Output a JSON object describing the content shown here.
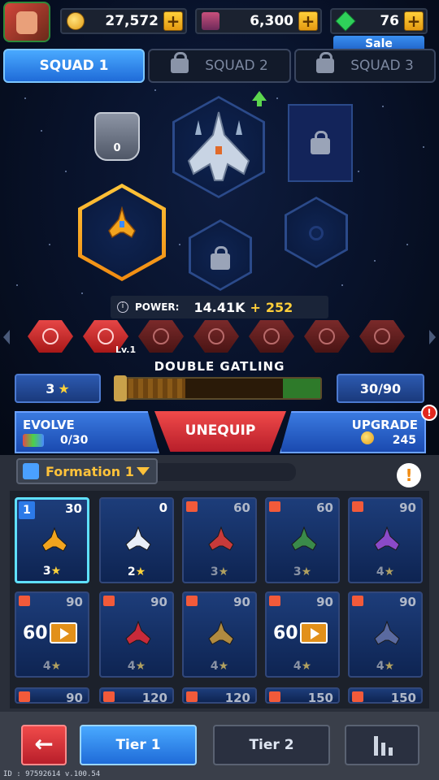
{
  "currency": {
    "coins": "27,572",
    "cards": "6,300",
    "gems": "76",
    "plus": "+",
    "sale_label": "Sale"
  },
  "tabs": [
    {
      "label": "SQUAD 1",
      "active": true
    },
    {
      "label": "SQUAD 2",
      "active": false
    },
    {
      "label": "SQUAD 3",
      "active": false
    }
  ],
  "formation_slots": {
    "rank_badge_value": "0"
  },
  "power": {
    "label": "POWER:",
    "value": "14.41K",
    "plus": "+",
    "bonus": "252"
  },
  "skills": {
    "level_label": "Lv.1"
  },
  "weapon": {
    "name": "DOUBLE GATLING",
    "stars": "3",
    "xp": "30/90",
    "xp_progress": 0.33
  },
  "actions": {
    "evolve_label": "EVOLVE",
    "evolve_progress": "0/30",
    "unequip_label": "UNEQUIP",
    "upgrade_label": "UPGRADE",
    "upgrade_cost": "245"
  },
  "formation": {
    "label": "Formation 1"
  },
  "cards": [
    {
      "slot": "1",
      "num": "30",
      "stars": "3",
      "locked": false,
      "selected": true,
      "color": "#f2a41e"
    },
    {
      "num": "0",
      "stars": "2",
      "locked": false,
      "selected": false,
      "color": "#e8eef8"
    },
    {
      "num": "60",
      "stars": "3",
      "locked": true,
      "color": "#c83a3a"
    },
    {
      "num": "60",
      "stars": "3",
      "locked": true,
      "color": "#3a8a4a"
    },
    {
      "num": "90",
      "stars": "4",
      "locked": true,
      "color": "#8a4ac8"
    },
    {
      "num": "90",
      "stars": "4",
      "locked": true,
      "ad": "60",
      "color": "#c8a04a"
    },
    {
      "num": "90",
      "stars": "4",
      "locked": true,
      "color": "#c82a3a"
    },
    {
      "num": "90",
      "stars": "4",
      "locked": true,
      "color": "#b08a40"
    },
    {
      "num": "90",
      "stars": "4",
      "locked": true,
      "ad": "60",
      "color": "#c8a04a"
    },
    {
      "num": "90",
      "stars": "4",
      "locked": true,
      "color": "#5a6aa0"
    },
    {
      "num": "90"
    },
    {
      "num": "120"
    },
    {
      "num": "120"
    },
    {
      "num": "150"
    },
    {
      "num": "150"
    }
  ],
  "bottom": {
    "back_glyph": "←",
    "tier1": "Tier 1",
    "tier2": "Tier 2"
  },
  "footer": {
    "version_text": "ID : 97592614 v.100.54"
  }
}
